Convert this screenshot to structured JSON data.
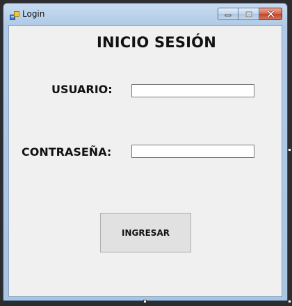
{
  "window": {
    "title": "Login",
    "icon": "winforms-form-icon",
    "buttons": {
      "minimize": "minimize-icon",
      "maximize": "maximize-icon",
      "close": "close-icon"
    }
  },
  "form": {
    "heading": "INICIO SESIÓN",
    "username_label": "USUARIO:",
    "username_value": "",
    "password_label": "CONTRASEÑA:",
    "password_value": "",
    "submit_label": "INGRESAR"
  },
  "colors": {
    "client_background": "#f0f0f0",
    "button_background": "#e1e1e1",
    "close_button": "#c44325"
  }
}
